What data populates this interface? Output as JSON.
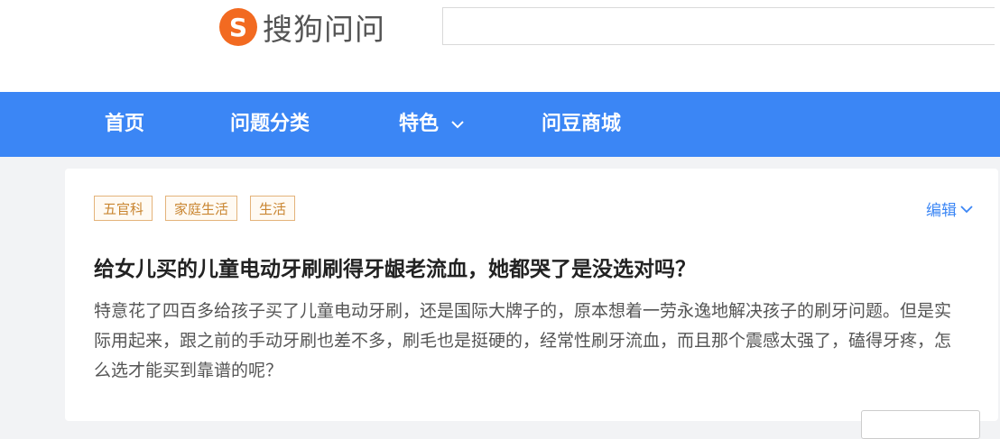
{
  "header": {
    "logo_mark": "S",
    "logo_text": "搜狗问问",
    "search": {
      "placeholder": "",
      "value": ""
    }
  },
  "nav": {
    "items": [
      {
        "label": "首页"
      },
      {
        "label": "问题分类"
      },
      {
        "label": "特色",
        "icon": "chevron-down-icon"
      },
      {
        "label": "问豆商城"
      }
    ]
  },
  "question": {
    "tags": [
      "五官科",
      "家庭生活",
      "生活"
    ],
    "edit_label": "编辑",
    "title": "给女儿买的儿童电动牙刷刷得牙龈老流血，她都哭了是没选对吗？",
    "body": "特意花了四百多给孩子买了儿童电动牙刷，还是国际大牌子的，原本想着一劳永逸地解决孩子的刷牙问题。但是实际用起来，跟之前的手动牙刷也差不多，刷毛也是挺硬的，经常性刷牙流血，而且那个震感太强了，磕得牙疼，怎么选才能买到靠谱的呢？"
  },
  "colors": {
    "brand_orange": "#f26a21",
    "nav_blue": "#3b86f5",
    "tag_orange": "#c98530",
    "link_blue": "#3b86f5"
  }
}
